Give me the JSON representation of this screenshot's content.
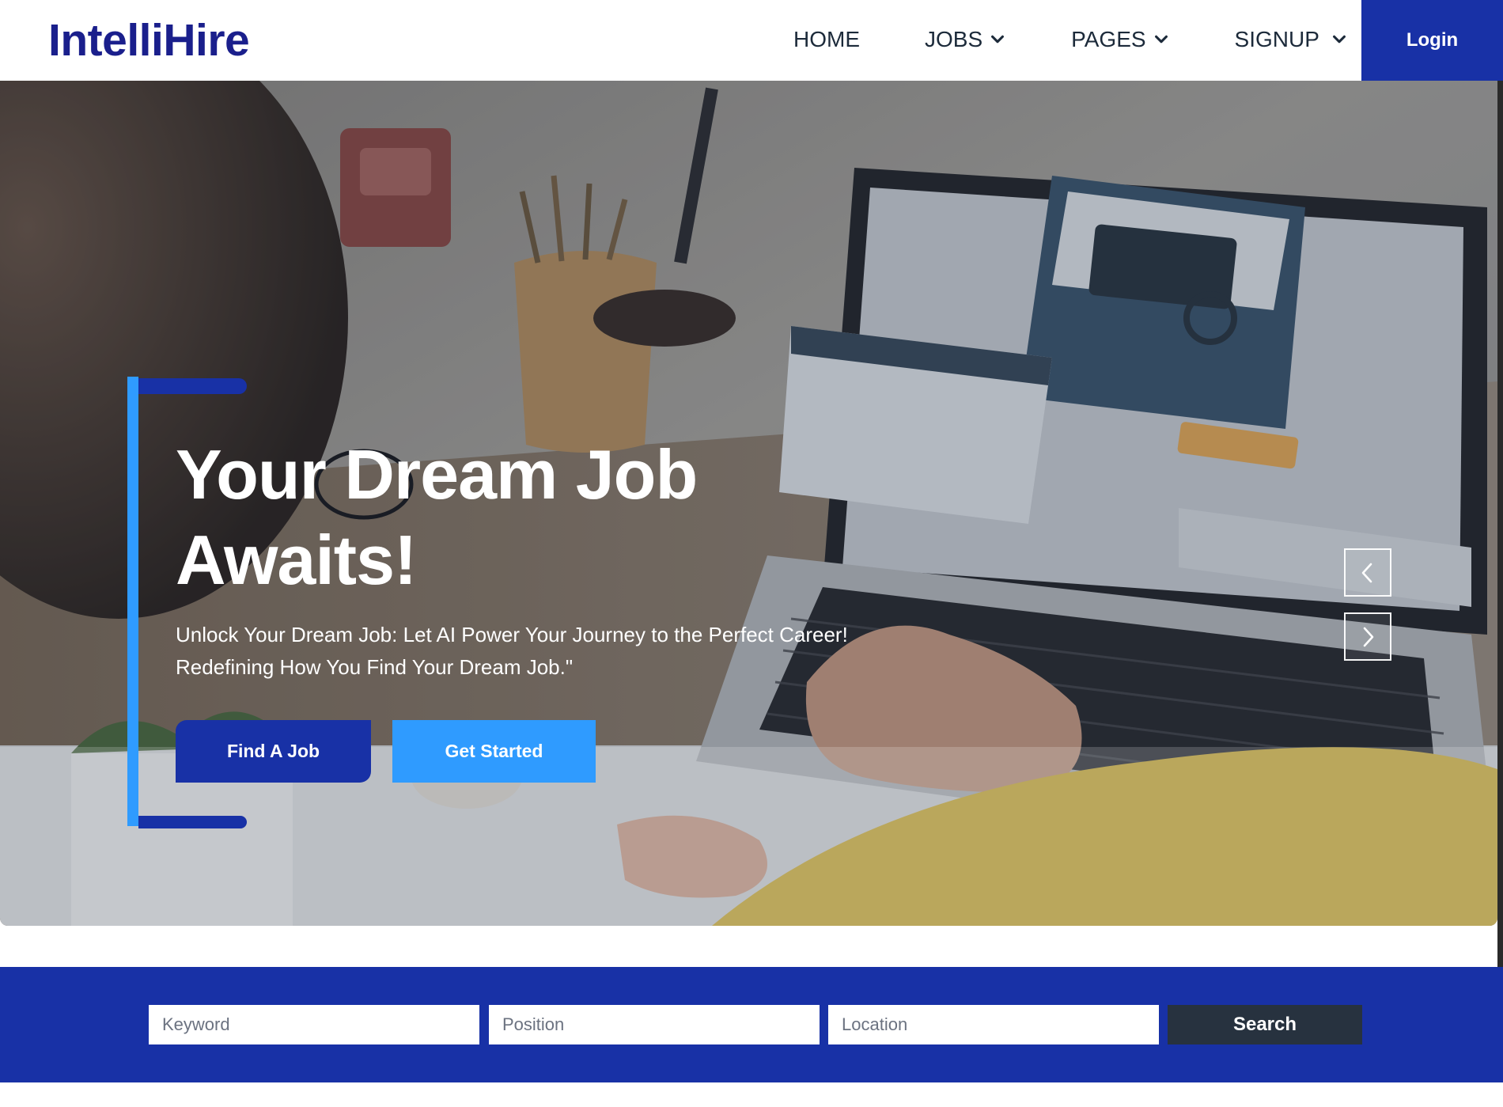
{
  "brand": {
    "name": "IntelliHire"
  },
  "nav": {
    "items": [
      {
        "label": "HOME",
        "dropdown": false
      },
      {
        "label": "JOBS",
        "dropdown": true
      },
      {
        "label": "PAGES",
        "dropdown": true
      },
      {
        "label": "SIGNUP",
        "dropdown": true
      }
    ],
    "login_label": "Login"
  },
  "hero": {
    "title_line1": "Your Dream Job",
    "title_line2": "Awaits!",
    "subtitle_line1": "Unlock Your Dream Job: Let AI Power Your Journey to the Perfect Career!",
    "subtitle_line2": "Redefining How You Find Your Dream Job.\"",
    "find_job_label": "Find A Job",
    "get_started_label": "Get Started",
    "prev_icon": "chevron-left-icon",
    "next_icon": "chevron-right-icon"
  },
  "search": {
    "keyword_placeholder": "Keyword",
    "position_placeholder": "Position",
    "location_placeholder": "Location",
    "button_label": "Search"
  },
  "colors": {
    "brand": "#1a1f8c",
    "primary": "#1831a6",
    "accent": "#2f9bff",
    "search_button": "#27323f"
  }
}
